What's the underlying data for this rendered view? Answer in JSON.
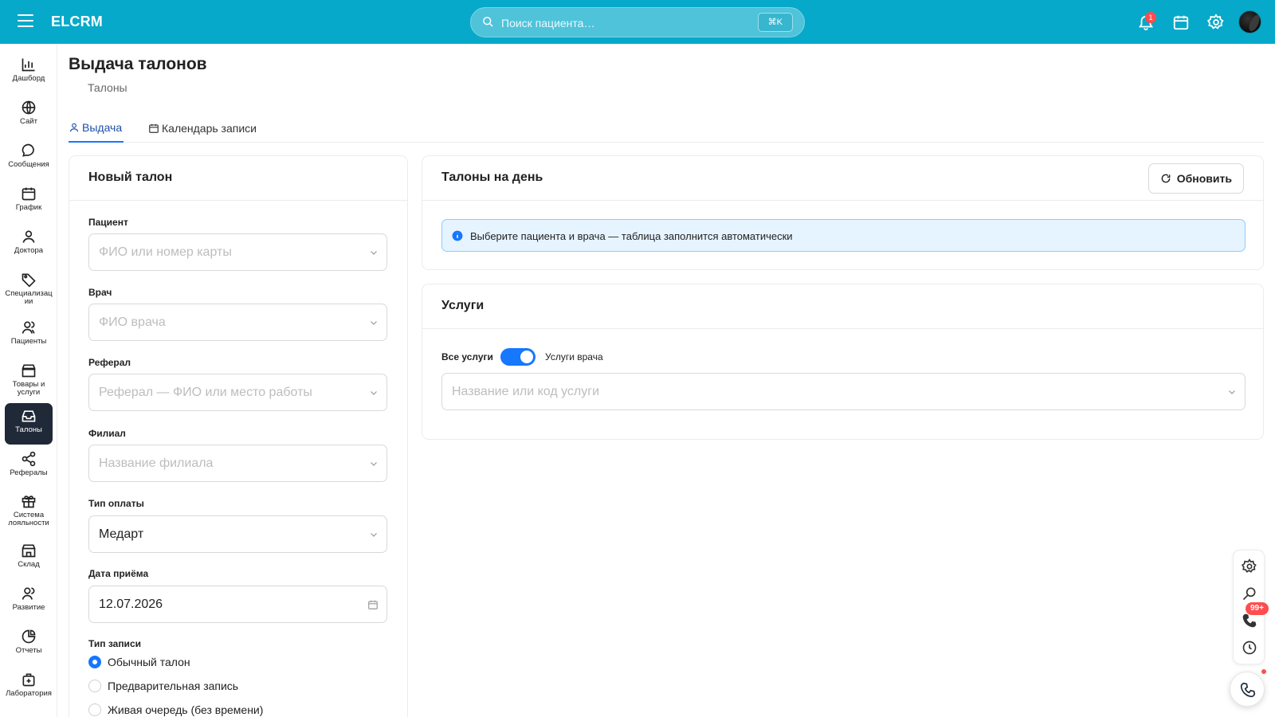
{
  "topbar": {
    "brand": "ELCRM",
    "search_placeholder": "Поиск пациента…",
    "shortcut": "⌘K",
    "notifications_count": "1",
    "accent_color": "#06a9c9"
  },
  "sidebar": {
    "items": [
      {
        "label": "Дашборд",
        "icon": "chart-icon"
      },
      {
        "label": "Сайт",
        "icon": "globe-icon"
      },
      {
        "label": "Сообщения",
        "icon": "chat-icon"
      },
      {
        "label": "График",
        "icon": "calendar-icon"
      },
      {
        "label": "Доктора",
        "icon": "user-icon"
      },
      {
        "label": "Специализации",
        "icon": "tag-icon"
      },
      {
        "label": "Пациенты",
        "icon": "users-icon"
      },
      {
        "label": "Товары и услуги",
        "icon": "shop-icon"
      },
      {
        "label": "Талоны",
        "icon": "inbox-icon",
        "active": true
      },
      {
        "label": "Рефералы",
        "icon": "share-icon"
      },
      {
        "label": "Система лояльности",
        "icon": "gift-icon"
      },
      {
        "label": "Склад",
        "icon": "warehouse-icon"
      },
      {
        "label": "Развитие",
        "icon": "growth-icon"
      },
      {
        "label": "Отчеты",
        "icon": "pie-chart-icon"
      },
      {
        "label": "Лаборатория",
        "icon": "lab-icon"
      }
    ]
  },
  "page": {
    "title": "Выдача талонов",
    "breadcrumb": "Талоны",
    "tabs": [
      {
        "label": "Выдача",
        "active": true
      },
      {
        "label": "Календарь записи"
      }
    ]
  },
  "new_ticket": {
    "title": "Новый талон",
    "patient_label": "Пациент",
    "patient_placeholder": "ФИО или номер карты",
    "doctor_label": "Врач",
    "doctor_placeholder": "ФИО врача",
    "referral_label": "Реферал",
    "referral_placeholder": "Реферал — ФИО или место работы",
    "branch_label": "Филиал",
    "branch_placeholder": "Название филиала",
    "payment_label": "Тип оплаты",
    "payment_value": "Медарт",
    "date_label": "Дата приёма",
    "date_value": "12.07.2026",
    "record_type_label": "Тип записи",
    "record_types": [
      {
        "label": "Обычный талон",
        "checked": true
      },
      {
        "label": "Предварительная запись",
        "checked": false
      },
      {
        "label": "Живая очередь (без времени)",
        "checked": false
      }
    ]
  },
  "day_tickets": {
    "title": "Талоны на день",
    "refresh_label": "Обновить",
    "info": "Выберите пациента и врача — таблица заполнится автоматически"
  },
  "services": {
    "title": "Услуги",
    "all_label": "Все услуги",
    "doctor_label": "Услуги врача",
    "toggle_on": true,
    "search_placeholder": "Название или код услуги"
  },
  "floating": {
    "badge": "99+"
  }
}
